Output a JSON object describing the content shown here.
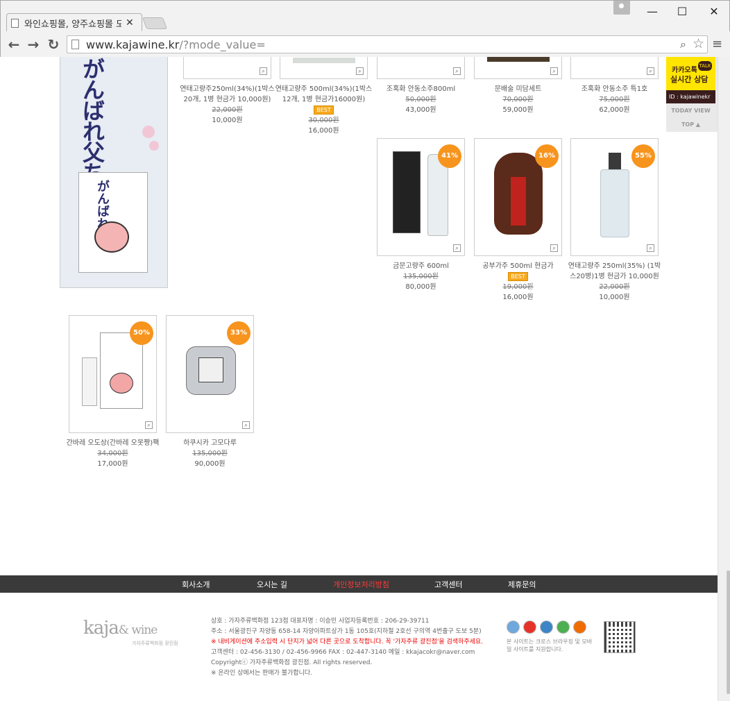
{
  "browser": {
    "tab_title": "와인쇼핑몰, 양주쇼핑몰 도",
    "url_host": "www.kajawine.kr",
    "url_path": "/?mode_value="
  },
  "top_row": [
    {
      "name": "연태고량주250ml(34%)(1박스20개, 1병 현금가 10,000원)",
      "old": "22,000원",
      "price": "10,000원",
      "best": ""
    },
    {
      "name": "연태고량주 500ml(34%)(1박스12개, 1병 현금가16000원)",
      "old": "30,000원",
      "price": "16,000원",
      "best": "BEST"
    },
    {
      "name": "조혹화 안동소주800ml",
      "old": "50,000원",
      "price": "43,000원",
      "best": ""
    },
    {
      "name": "문배술 미담세트",
      "old": "70,000원",
      "price": "59,000원",
      "best": ""
    },
    {
      "name": "조혹화 안동소주 특1호",
      "old": "75,000원",
      "price": "62,000원",
      "best": ""
    }
  ],
  "mid_row": [
    {
      "name": "금문고량주 600ml",
      "old": "135,000원",
      "price": "80,000원",
      "badge": "41%",
      "best": ""
    },
    {
      "name": "공부가주 500ml 현금가",
      "old": "19,000원",
      "price": "16,000원",
      "badge": "16%",
      "best": "BEST"
    },
    {
      "name": "연태고량주 250ml(35%) (1박스20병)1병 현금가 10,000원",
      "old": "22,000원",
      "price": "10,000원",
      "badge": "55%",
      "best": ""
    }
  ],
  "bottom_row": [
    {
      "name": "간바레 오도상(간바레 오못짱)팩",
      "old": "34,000원",
      "price": "17,000원",
      "badge": "50%"
    },
    {
      "name": "하쿠시카 고모다루",
      "old": "135,000원",
      "price": "90,000원",
      "badge": "33%"
    }
  ],
  "right_widget": {
    "kakao_line1": "카카오톡",
    "kakao_line2": "실시간 상담",
    "kakao_talk": "TALK",
    "kakao_id": "ID : kajawinekr",
    "today_view": "TODAY VIEW",
    "top": "TOP ▲"
  },
  "footer_nav": [
    "회사소개",
    "오시는 길",
    "개인정보처리방침",
    "고객센터",
    "제휴문의"
  ],
  "footer_logo": {
    "main": "kaja",
    "amp": "& wine",
    "sub": "가자주류백화점 광진점"
  },
  "footer_info": {
    "line1": "상호 : 가자주류백화점 123점 대표자명 : 이승민 사업자등록번호 : 206-29-39711",
    "line2": "주소 : 서울광진구 자양동 658-14 자양아파트상가 1동 105호(지하철 2호선 구의역 4번출구 도보 5분)",
    "line3": "※ 내비게이션에 주소입력 시 단지가 넓어 다른 곳으로 도착합니다. 꼭 '가자주류 광진점'을 검색하주세요.",
    "line4": "고객센터 : 02-456-3130 / 02-456-9966 FAX : 02-447-3140 메일 : kkajacokr@naver.com",
    "line5": "Copyrightⓒ 가자주류백화점 광진점. All rights reserved.",
    "line6": "※ 온라인 상에서는 판매가 불가합니다."
  },
  "browsers_note": "본 사이트는 크로스 브라우징 및 모바일 사이트를 지원합니다.",
  "banner_text": "がんばれ父ちゃん",
  "colors": {
    "badge": "#f7941d",
    "footer_bg": "#3a3a3a",
    "kakao": "#ffe500",
    "accent_red": "#ff3b3b"
  }
}
